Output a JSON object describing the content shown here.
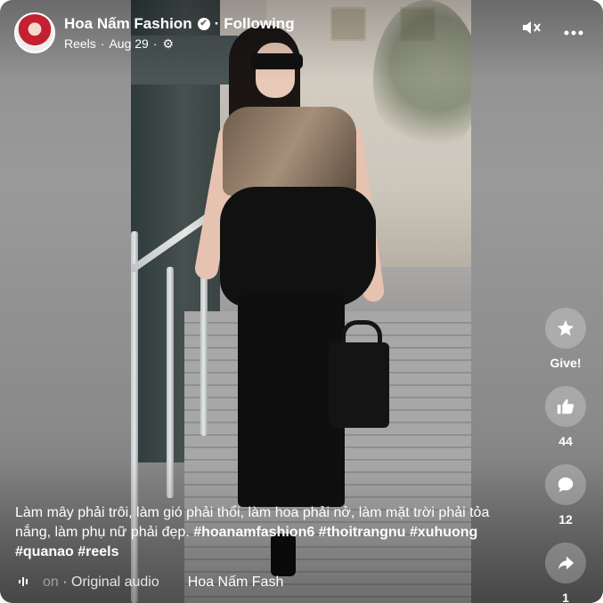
{
  "header": {
    "page_name": "Hoa Nấm Fashion",
    "verified": "✔",
    "following": "Following",
    "separator": "·",
    "sub_type": "Reels",
    "date": "Aug 29",
    "privacy_icon": "gear-icon"
  },
  "controls": {
    "mute_icon": "speaker-muted-icon",
    "more_icon": "more-icon"
  },
  "actions": [
    {
      "icon": "star-icon",
      "label": "Give!"
    },
    {
      "icon": "like-icon",
      "label": "44"
    },
    {
      "icon": "comment-icon",
      "label": "12"
    },
    {
      "icon": "share-icon",
      "label": "1"
    }
  ],
  "caption": {
    "text": "Làm mây phải trôi, làm gió phải thổi, làm hoa phải nở, làm mặt trời phải tỏa nắng, làm phụ nữ phải đẹp.",
    "hashtags": "#hoanamfashion6 #thoitrangnu #xuhuong #quanao #reels"
  },
  "audio": {
    "faded_prefix": "on",
    "label": "· Original audio",
    "creator": "Hoa Nấm Fash"
  },
  "colors": {
    "overlay_text": "#ffffff"
  }
}
